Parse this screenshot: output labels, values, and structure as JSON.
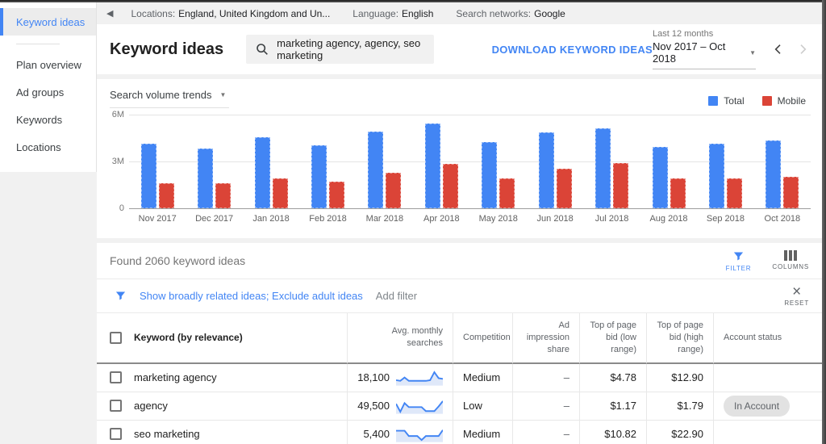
{
  "icons": {
    "back_glyph": "◀",
    "caret_glyph": "▼",
    "close_glyph": "×"
  },
  "colors": {
    "accent_blue": "#4285f4",
    "bar_red": "#db4437",
    "panel": "#ffffff",
    "page_bg": "#f1f1f1"
  },
  "topbar": {
    "items": [
      {
        "label": "Locations:",
        "value": "England, United Kingdom and Un..."
      },
      {
        "label": "Language:",
        "value": "English"
      },
      {
        "label": "Search networks:",
        "value": "Google"
      }
    ]
  },
  "sidebar": {
    "items": [
      {
        "label": "Keyword ideas",
        "active": true
      },
      {
        "label": "Plan overview",
        "active": false
      },
      {
        "label": "Ad groups",
        "active": false
      },
      {
        "label": "Keywords",
        "active": false
      },
      {
        "label": "Locations",
        "active": false
      }
    ]
  },
  "header": {
    "title": "Keyword ideas",
    "search_value": "marketing agency, agency, seo marketing",
    "download_label": "DOWNLOAD KEYWORD IDEAS",
    "date_range_label": "Last 12 months",
    "date_range": "Nov 2017 – Oct 2018"
  },
  "chart": {
    "dropdown_label": "Search volume trends"
  },
  "chart_data": {
    "type": "bar",
    "title": "Search volume trends",
    "categories": [
      "Nov 2017",
      "Dec 2017",
      "Jan 2018",
      "Feb 2018",
      "Mar 2018",
      "Apr 2018",
      "May 2018",
      "Jun 2018",
      "Jul 2018",
      "Aug 2018",
      "Sep 2018",
      "Oct 2018"
    ],
    "series": [
      {
        "name": "Total",
        "color": "#4285f4",
        "values": [
          4.1,
          3.8,
          4.5,
          4.0,
          4.85,
          5.4,
          4.2,
          4.8,
          5.1,
          3.9,
          4.1,
          4.3
        ]
      },
      {
        "name": "Mobile",
        "color": "#db4437",
        "values": [
          1.6,
          1.6,
          1.9,
          1.7,
          2.25,
          2.8,
          1.9,
          2.5,
          2.9,
          1.9,
          1.9,
          2.0
        ]
      }
    ],
    "unit": "millions of monthly searches",
    "ylim": [
      0,
      6
    ],
    "yticks": [
      "6M",
      "3M",
      "0"
    ],
    "legend_position": "top-right",
    "grid": true
  },
  "results": {
    "found_text": "Found 2060 keyword ideas",
    "filter_label": "FILTER",
    "columns_label": "COLUMNS",
    "filter_chips": "Show broadly related ideas; Exclude adult ideas",
    "add_filter": "Add filter",
    "reset_label": "RESET"
  },
  "table": {
    "headers": [
      "Keyword (by relevance)",
      "Avg. monthly searches",
      "Competition",
      "Ad impression share",
      "Top of page bid (low range)",
      "Top of page bid (high range)",
      "Account status"
    ],
    "aligns": [
      "left",
      "right",
      "left",
      "right",
      "right",
      "right",
      "left"
    ],
    "rows": [
      {
        "keyword": "marketing agency",
        "avg_monthly_searches": "18,100",
        "spark": [
          3.5,
          3,
          5.5,
          3,
          3,
          3,
          3,
          3,
          3.5,
          9.5,
          5,
          4.5
        ],
        "competition": "Medium",
        "ad_impression_share": "–",
        "top_bid_low": "$4.78",
        "top_bid_high": "$12.90",
        "account_status": ""
      },
      {
        "keyword": "agency",
        "avg_monthly_searches": "49,500",
        "spark": [
          7,
          1,
          7.5,
          4.5,
          4.5,
          4.5,
          4.5,
          1.5,
          1.5,
          1.5,
          5,
          9
        ],
        "competition": "Low",
        "ad_impression_share": "–",
        "top_bid_low": "$1.17",
        "top_bid_high": "$1.79",
        "account_status": "In Account"
      },
      {
        "keyword": "seo marketing",
        "avg_monthly_searches": "5,400",
        "spark": [
          8,
          8,
          8,
          4,
          4,
          4,
          1,
          4,
          4,
          4,
          4,
          8.5
        ],
        "competition": "Medium",
        "ad_impression_share": "–",
        "top_bid_low": "$10.82",
        "top_bid_high": "$22.90",
        "account_status": ""
      }
    ]
  }
}
